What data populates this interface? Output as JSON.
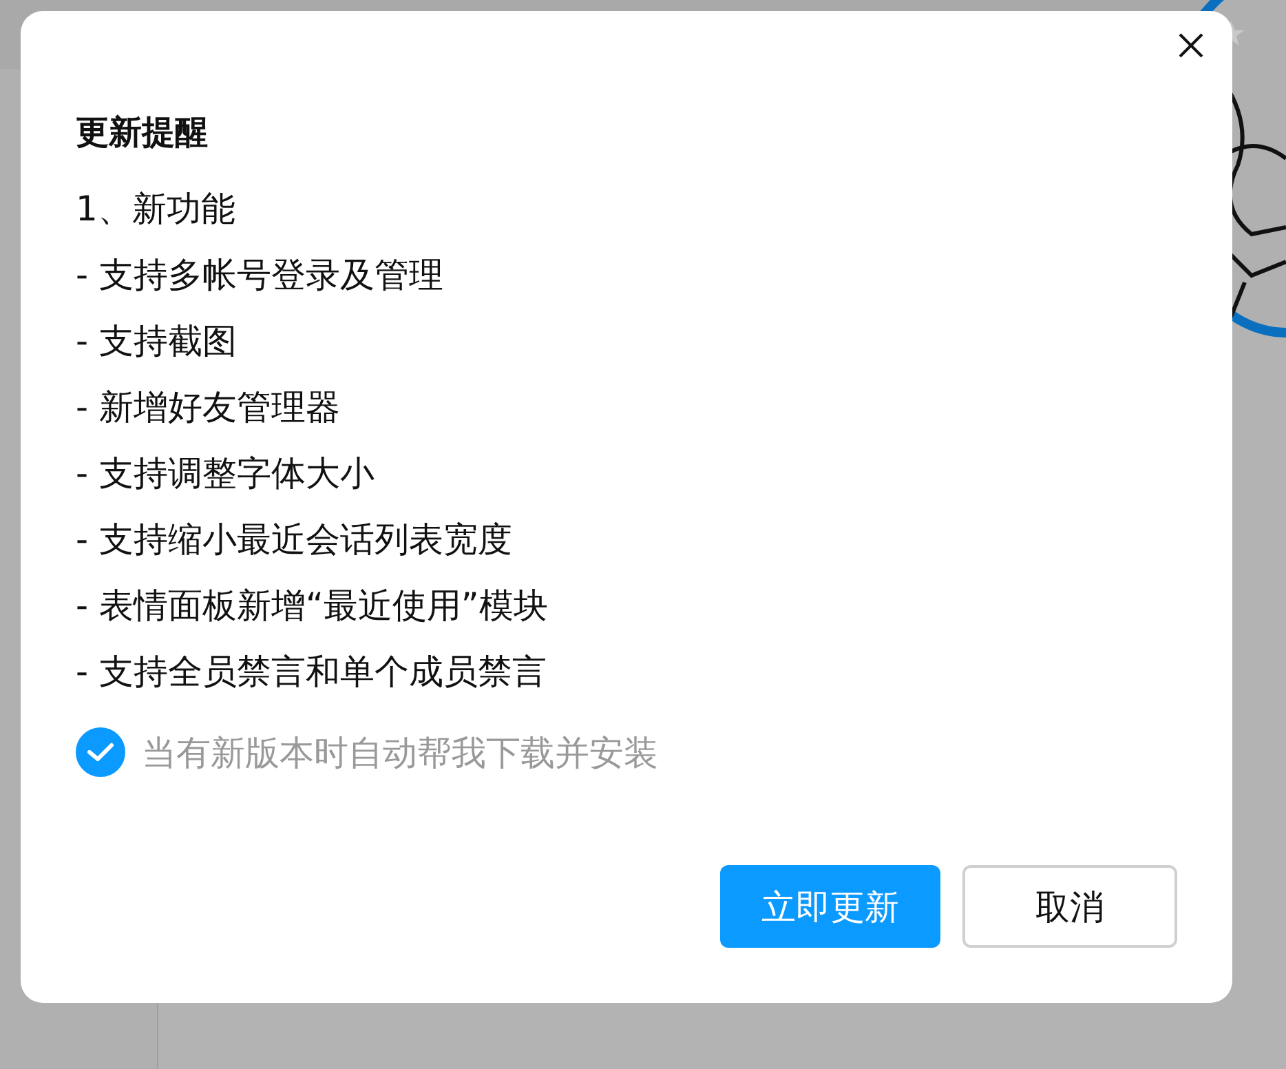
{
  "dialog": {
    "title": "更新提醒",
    "lines": [
      "1、新功能",
      "- 支持多帐号登录及管理",
      "- 支持截图",
      "- 新增好友管理器",
      "- 支持调整字体大小",
      "- 支持缩小最近会话列表宽度",
      "- 表情面板新增“最近使用”模块",
      "- 支持全员禁言和单个成员禁言"
    ],
    "auto_update": {
      "label": "当有新版本时自动帮我下载并安装",
      "checked": true
    },
    "buttons": [
      {
        "label": "立即更新",
        "kind": "primary"
      },
      {
        "label": "取消",
        "kind": "secondary"
      }
    ]
  }
}
